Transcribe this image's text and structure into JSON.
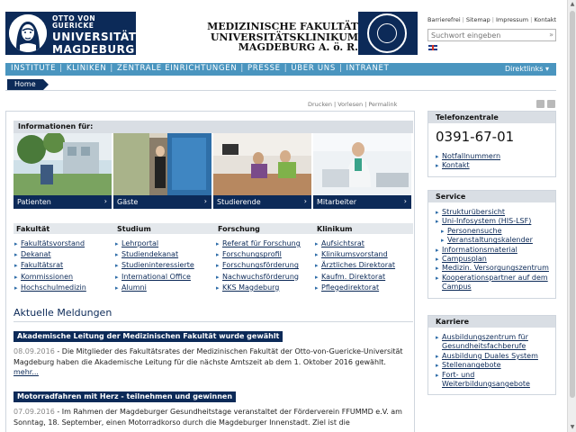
{
  "header": {
    "logo": {
      "line1": "OTTO VON GUERICKE",
      "line2": "UNIVERSITÄT",
      "line3": "MAGDEBURG"
    },
    "faculty_line1": "MEDIZINISCHE FAKULTÄT",
    "faculty_line2": "UNIVERSITÄTSKLINIKUM MAGDEBURG A. ö. R.",
    "toplinks": [
      "Barrierefrei",
      "Sitemap",
      "Impressum",
      "Kontakt"
    ],
    "search_placeholder": "Suchwort eingeben",
    "search_button": "»"
  },
  "nav": {
    "items": [
      "INSTITUTE",
      "KLINIKEN",
      "ZENTRALE EINRICHTUNGEN",
      "PRESSE",
      "ÜBER UNS",
      "INTRANET"
    ],
    "direktlinks": "Direktlinks ▾"
  },
  "breadcrumb": {
    "home": "Home"
  },
  "tools": {
    "print": "Drucken",
    "read": "Vorlesen",
    "permalink": "Permalink"
  },
  "info": {
    "heading": "Informationen für:",
    "tiles": [
      {
        "label": "Patienten",
        "chev": "›"
      },
      {
        "label": "Gäste",
        "chev": "›"
      },
      {
        "label": "Studierende",
        "chev": "›"
      },
      {
        "label": "Mitarbeiter",
        "chev": "›"
      }
    ]
  },
  "columns": [
    {
      "heading": "Fakultät",
      "links": [
        "Fakultätsvorstand",
        "Dekanat",
        "Fakultätsrat",
        "Kommissionen",
        "Hochschulmedizin"
      ]
    },
    {
      "heading": "Studium",
      "links": [
        "Lehrportal",
        "Studiendekanat",
        "Studieninteressierte",
        "International Office",
        "Alumni"
      ]
    },
    {
      "heading": "Forschung",
      "links": [
        "Referat für Forschung",
        "Forschungsprofil",
        "Forschungsförderung",
        "Nachwuchsförderung",
        "KKS Magdeburg"
      ]
    },
    {
      "heading": "Klinikum",
      "links": [
        "Aufsichtsrat",
        "Klinikumsvorstand",
        "Ärztliches Direktorat",
        "Kaufm. Direktorat",
        "Pflegedirektorat"
      ]
    }
  ],
  "news": {
    "title": "Aktuelle Meldungen",
    "items": [
      {
        "headline": "Akademische Leitung der Medizinischen Fakultät wurde gewählt",
        "date": "08.09.2016",
        "text": " - Die Mitglieder des Fakultätsrates der Medizinischen Fakultät der Otto-von-Guericke-Universität Magdeburg haben die Akademische Leitung für die nächste Amtszeit ab dem 1. Oktober 2016 gewählt.",
        "more": "mehr..."
      },
      {
        "headline": "Motorradfahren mit Herz - teilnehmen und gewinnen",
        "date": "07.09.2016",
        "text": " - Im Rahmen der Magdeburger Gesundheitstage veranstaltet der Förderverein FFUMMD e.V. am Sonntag, 18. September, einen Motorradkorso durch die Magdeburger Innenstadt. Ziel ist die"
      }
    ]
  },
  "sidebar": {
    "telefon": {
      "heading": "Telefonzentrale",
      "number": "0391-67-01",
      "links": [
        "Notfallnummern",
        "Kontakt"
      ]
    },
    "service": {
      "heading": "Service",
      "links": [
        {
          "label": "Strukturübersicht",
          "sub": false
        },
        {
          "label": "Uni-Infosystem (HIS-LSF)",
          "sub": false
        },
        {
          "label": "Personensuche",
          "sub": true
        },
        {
          "label": "Veranstaltungskalender",
          "sub": true
        },
        {
          "label": "Informationsmaterial",
          "sub": false
        },
        {
          "label": "Campusplan",
          "sub": false
        },
        {
          "label": "Medizin. Versorgungszentrum",
          "sub": false
        },
        {
          "label": "Kooperationspartner auf dem Campus",
          "sub": false
        }
      ]
    },
    "karriere": {
      "heading": "Karriere",
      "links": [
        "Ausbildungszentrum für Gesundheitsfachberufe",
        "Ausbildung Duales System",
        "Stellenangebote",
        "Fort- und Weiterbildungsangebote"
      ]
    }
  },
  "colors": {
    "dark_blue": "#0c2a58",
    "nav_blue": "#4a95bf",
    "light_grey": "#d9dee4"
  }
}
